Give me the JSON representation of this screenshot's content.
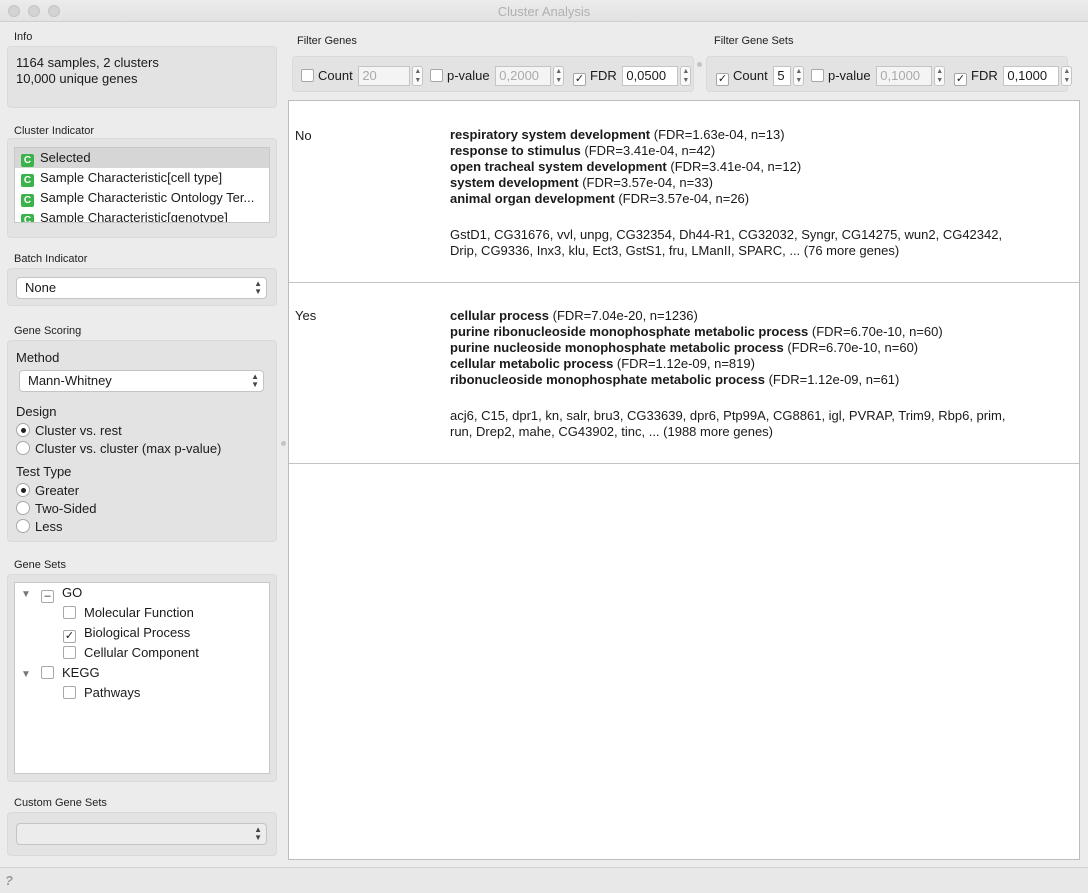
{
  "window": {
    "title": "Cluster Analysis"
  },
  "info": {
    "label": "Info",
    "line1": "1164 samples, 2 clusters",
    "line2": "10,000 unique genes"
  },
  "cluster_indicator": {
    "label": "Cluster Indicator",
    "badge": "C",
    "items": [
      "Selected",
      "Sample Characteristic[cell type]",
      "Sample Characteristic Ontology Ter...",
      "Sample Characteristic[genotype]"
    ]
  },
  "batch_indicator": {
    "label": "Batch Indicator",
    "value": "None"
  },
  "gene_scoring": {
    "label": "Gene Scoring",
    "method_label": "Method",
    "method_value": "Mann-Whitney",
    "design_label": "Design",
    "design_options": [
      "Cluster vs. rest",
      "Cluster vs. cluster (max p-value)"
    ],
    "test_type_label": "Test Type",
    "test_type_options": [
      "Greater",
      "Two-Sided",
      "Less"
    ]
  },
  "gene_sets": {
    "label": "Gene Sets",
    "tree": {
      "go": "GO",
      "molecular_function": "Molecular Function",
      "biological_process": "Biological Process",
      "cellular_component": "Cellular Component",
      "kegg": "KEGG",
      "pathways": "Pathways"
    },
    "check_mark": "✓",
    "partial_mark": "–"
  },
  "custom_gene_sets": {
    "label": "Custom Gene Sets",
    "value": ""
  },
  "filter_genes": {
    "label": "Filter Genes",
    "count_label": "Count",
    "count_value": "20",
    "pvalue_label": "p-value",
    "pvalue_value": "0,2000",
    "fdr_label": "FDR",
    "fdr_value": "0,0500"
  },
  "filter_gene_sets": {
    "label": "Filter Gene Sets",
    "count_label": "Count",
    "count_value": "5",
    "pvalue_label": "p-value",
    "pvalue_value": "0,1000",
    "fdr_label": "FDR",
    "fdr_value": "0,1000"
  },
  "results": [
    {
      "cluster": "No",
      "terms": [
        {
          "name": "respiratory system development",
          "stats": " (FDR=1.63e-04, n=13)"
        },
        {
          "name": "response to stimulus",
          "stats": " (FDR=3.41e-04, n=42)"
        },
        {
          "name": "open tracheal system development",
          "stats": " (FDR=3.41e-04, n=12)"
        },
        {
          "name": "system development",
          "stats": " (FDR=3.57e-04, n=33)"
        },
        {
          "name": "animal organ development",
          "stats": " (FDR=3.57e-04, n=26)"
        }
      ],
      "genes_line1": "GstD1, CG31676, vvl, unpg, CG32354, Dh44-R1, CG32032, Syngr, CG14275, wun2, CG42342,",
      "genes_line2": "Drip, CG9336, Inx3, klu, Ect3, GstS1, fru, LManII, SPARC, ... (76 more genes)"
    },
    {
      "cluster": "Yes",
      "terms": [
        {
          "name": "cellular process",
          "stats": " (FDR=7.04e-20, n=1236)"
        },
        {
          "name": "purine ribonucleoside monophosphate metabolic process",
          "stats": " (FDR=6.70e-10, n=60)"
        },
        {
          "name": "purine nucleoside monophosphate metabolic process",
          "stats": " (FDR=6.70e-10, n=60)"
        },
        {
          "name": "cellular metabolic process",
          "stats": " (FDR=1.12e-09, n=819)"
        },
        {
          "name": "ribonucleoside monophosphate metabolic process",
          "stats": " (FDR=1.12e-09, n=61)"
        }
      ],
      "genes_line1": "acj6, C15, dpr1, kn, salr, bru3, CG33639, dpr6, Ptp99A, CG8861, igl, PVRAP, Trim9, Rbp6, prim,",
      "genes_line2": "run, Drep2, mahe, CG43902, tinc, ... (1988 more genes)"
    }
  ],
  "status": {
    "help": "?"
  }
}
